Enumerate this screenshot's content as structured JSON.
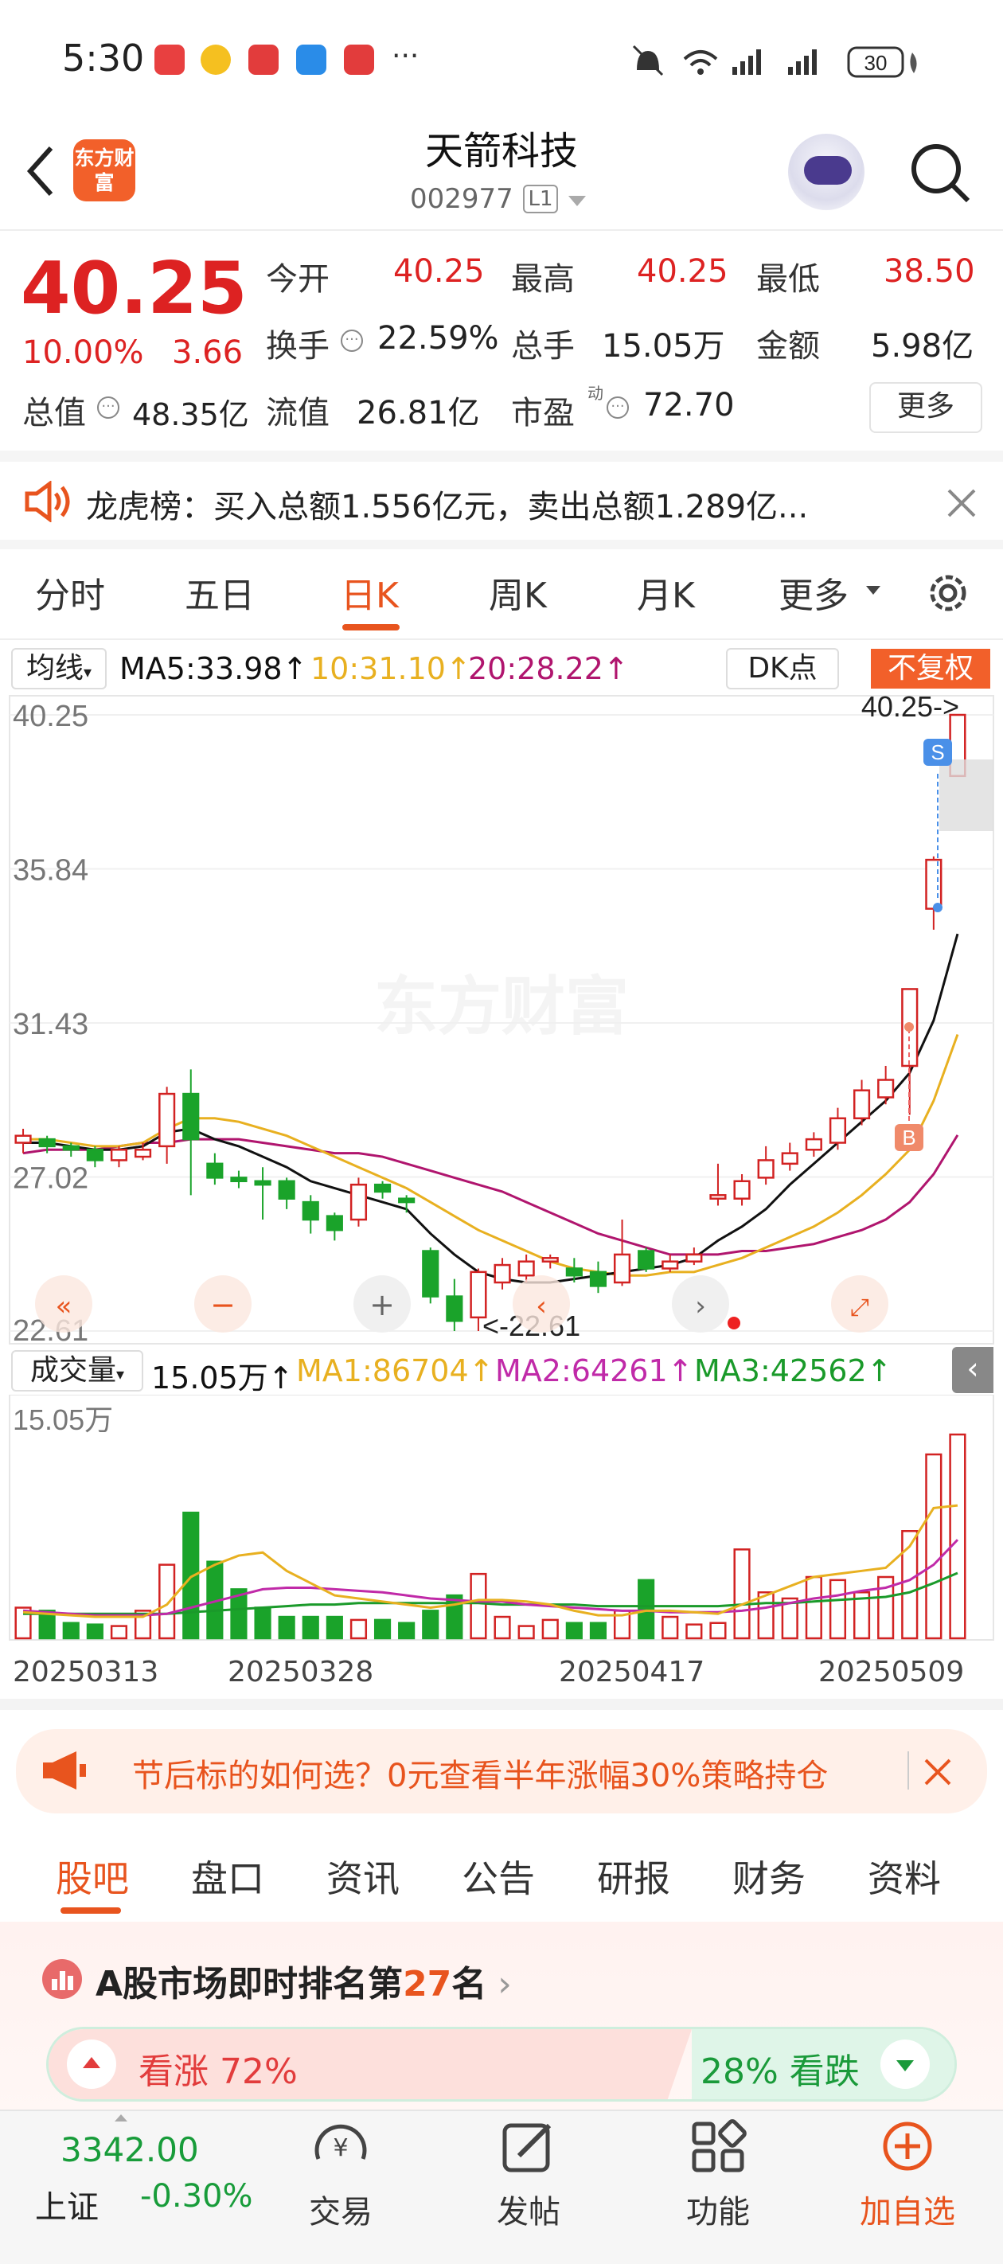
{
  "status_bar": {
    "time": "5:30",
    "battery": "30"
  },
  "header": {
    "logo_text": "东方财富",
    "title": "天箭科技",
    "code": "002977",
    "level_badge": "L1"
  },
  "quote": {
    "price": "40.25",
    "change_pct": "10.00%",
    "change": "3.66",
    "open_label": "今开",
    "open": "40.25",
    "high_label": "最高",
    "high": "40.25",
    "low_label": "最低",
    "low": "38.50",
    "turnover_label": "换手",
    "turnover": "22.59%",
    "volume_label": "总手",
    "volume": "15.05万",
    "amount_label": "金额",
    "amount": "5.98亿",
    "mktcap_label": "总值",
    "mktcap": "48.35亿",
    "float_label": "流值",
    "float": "26.81亿",
    "pe_label": "市盈",
    "pe_sup": "动",
    "pe": "72.70",
    "more": "更多"
  },
  "notice": {
    "text": "龙虎榜：买入总额1.556亿元，卖出总额1.289亿..."
  },
  "chart_tabs": [
    "分时",
    "五日",
    "日K",
    "周K",
    "月K",
    "更多"
  ],
  "chart_tabs_active": 2,
  "kline": {
    "ma_selector": "均线",
    "ma5": "MA5:33.98↑",
    "ma10": "10:31.10↑",
    "ma20": "20:28.22↑",
    "dk": "DK点",
    "adjust": "不复权",
    "y_labels": [
      "40.25",
      "35.84",
      "31.43",
      "27.02",
      "22.61"
    ],
    "high_marker": "40.25->",
    "low_marker": "<-22.61",
    "sell_badge": "S",
    "buy_badge": "B",
    "watermark": "东方财富"
  },
  "volume": {
    "selector": "成交量",
    "current": "15.05万↑",
    "ma1": "MA1:86704↑",
    "ma2": "MA2:64261↑",
    "ma3": "MA3:42562↑",
    "max_label": "15.05万",
    "x_labels": [
      "20250313",
      "20250328",
      "20250417",
      "20250509"
    ]
  },
  "chart_data": {
    "type": "candlestick",
    "ylim": [
      22.61,
      40.25
    ],
    "candles": [
      {
        "o": 28.0,
        "c": 28.2,
        "h": 28.4,
        "l": 27.7
      },
      {
        "o": 28.1,
        "c": 27.9,
        "h": 28.2,
        "l": 27.7
      },
      {
        "o": 27.9,
        "c": 27.8,
        "h": 28.0,
        "l": 27.6
      },
      {
        "o": 27.8,
        "c": 27.5,
        "h": 27.9,
        "l": 27.3
      },
      {
        "o": 27.5,
        "c": 27.8,
        "h": 27.9,
        "l": 27.3
      },
      {
        "o": 27.6,
        "c": 27.8,
        "h": 28.0,
        "l": 27.5
      },
      {
        "o": 27.9,
        "c": 29.4,
        "h": 29.6,
        "l": 27.4
      },
      {
        "o": 29.4,
        "c": 28.1,
        "h": 30.1,
        "l": 26.5
      },
      {
        "o": 27.4,
        "c": 27.0,
        "h": 27.7,
        "l": 26.8
      },
      {
        "o": 27.0,
        "c": 26.9,
        "h": 27.2,
        "l": 26.7
      },
      {
        "o": 26.9,
        "c": 26.8,
        "h": 27.3,
        "l": 25.8
      },
      {
        "o": 26.9,
        "c": 26.4,
        "h": 27.0,
        "l": 26.1
      },
      {
        "o": 26.3,
        "c": 25.8,
        "h": 26.5,
        "l": 25.4
      },
      {
        "o": 25.9,
        "c": 25.5,
        "h": 26.0,
        "l": 25.2
      },
      {
        "o": 25.8,
        "c": 26.8,
        "h": 27.0,
        "l": 25.6
      },
      {
        "o": 26.8,
        "c": 26.6,
        "h": 26.9,
        "l": 26.4
      },
      {
        "o": 26.4,
        "c": 26.3,
        "h": 26.5,
        "l": 26.0
      },
      {
        "o": 24.9,
        "c": 23.6,
        "h": 25.0,
        "l": 23.4
      },
      {
        "o": 23.6,
        "c": 22.9,
        "h": 24.1,
        "l": 22.61
      },
      {
        "o": 23.0,
        "c": 24.3,
        "h": 24.4,
        "l": 22.61
      },
      {
        "o": 24.0,
        "c": 24.5,
        "h": 24.7,
        "l": 23.8
      },
      {
        "o": 24.2,
        "c": 24.6,
        "h": 24.8,
        "l": 24.0
      },
      {
        "o": 24.6,
        "c": 24.7,
        "h": 24.8,
        "l": 24.4
      },
      {
        "o": 24.4,
        "c": 24.2,
        "h": 24.7,
        "l": 24.0
      },
      {
        "o": 24.3,
        "c": 23.9,
        "h": 24.6,
        "l": 23.7
      },
      {
        "o": 24.0,
        "c": 24.8,
        "h": 25.8,
        "l": 23.9
      },
      {
        "o": 24.9,
        "c": 24.4,
        "h": 25.0,
        "l": 24.3
      },
      {
        "o": 24.4,
        "c": 24.6,
        "h": 24.8,
        "l": 24.3
      },
      {
        "o": 24.6,
        "c": 24.8,
        "h": 25.0,
        "l": 24.5
      },
      {
        "o": 26.4,
        "c": 26.5,
        "h": 27.4,
        "l": 26.2
      },
      {
        "o": 26.4,
        "c": 26.9,
        "h": 27.1,
        "l": 26.2
      },
      {
        "o": 27.0,
        "c": 27.5,
        "h": 27.9,
        "l": 26.8
      },
      {
        "o": 27.4,
        "c": 27.7,
        "h": 28.0,
        "l": 27.2
      },
      {
        "o": 27.8,
        "c": 28.1,
        "h": 28.3,
        "l": 27.6
      },
      {
        "o": 28.0,
        "c": 28.7,
        "h": 29.0,
        "l": 27.8
      },
      {
        "o": 28.7,
        "c": 29.5,
        "h": 29.8,
        "l": 28.5
      },
      {
        "o": 29.3,
        "c": 29.8,
        "h": 30.2,
        "l": 29.1
      },
      {
        "o": 30.2,
        "c": 32.4,
        "h": 32.4,
        "l": 28.8
      },
      {
        "o": 34.7,
        "c": 36.1,
        "h": 36.2,
        "l": 34.1
      },
      {
        "o": 38.5,
        "c": 40.25,
        "h": 40.25,
        "l": 38.5
      }
    ],
    "ma5": [
      28.0,
      28.0,
      27.9,
      27.8,
      27.8,
      27.9,
      28.3,
      28.4,
      28.1,
      27.9,
      27.6,
      27.3,
      26.9,
      26.7,
      26.5,
      26.3,
      26.1,
      25.4,
      24.8,
      24.3,
      24.1,
      24.0,
      24.0,
      24.1,
      24.2,
      24.3,
      24.4,
      24.5,
      24.7,
      25.2,
      25.6,
      26.1,
      26.8,
      27.4,
      28.0,
      28.6,
      29.2,
      30.0,
      31.5,
      33.98
    ],
    "ma10": [
      28.1,
      28.1,
      28.0,
      27.9,
      27.9,
      28.0,
      28.4,
      28.7,
      28.7,
      28.6,
      28.4,
      28.2,
      27.9,
      27.6,
      27.3,
      27.0,
      26.7,
      26.3,
      25.9,
      25.5,
      25.2,
      24.9,
      24.6,
      24.4,
      24.3,
      24.2,
      24.2,
      24.3,
      24.3,
      24.5,
      24.7,
      25.0,
      25.3,
      25.6,
      26.0,
      26.5,
      27.1,
      27.8,
      29.2,
      31.1
    ],
    "ma20": [
      27.7,
      27.8,
      27.8,
      27.8,
      27.9,
      28.0,
      28.0,
      28.1,
      28.1,
      28.1,
      28.0,
      27.9,
      27.8,
      27.7,
      27.7,
      27.6,
      27.4,
      27.2,
      27.0,
      26.8,
      26.6,
      26.3,
      26.0,
      25.7,
      25.4,
      25.2,
      25.0,
      24.8,
      24.8,
      24.8,
      24.9,
      24.9,
      25.0,
      25.1,
      25.3,
      25.5,
      25.8,
      26.3,
      27.1,
      28.22
    ],
    "volumes": [
      20,
      18,
      10,
      9,
      8,
      18,
      48,
      82,
      50,
      32,
      20,
      14,
      14,
      14,
      12,
      12,
      10,
      18,
      28,
      42,
      14,
      8,
      12,
      10,
      10,
      18,
      38,
      14,
      9,
      10,
      58,
      30,
      26,
      40,
      38,
      30,
      40,
      70,
      120,
      133
    ],
    "vol_ma1": [
      17,
      16,
      15,
      14,
      14,
      14,
      22,
      40,
      48,
      54,
      56,
      44,
      36,
      28,
      26,
      24,
      22,
      20,
      22,
      25,
      25,
      24,
      22,
      18,
      15,
      15,
      18,
      18,
      17,
      16,
      22,
      28,
      34,
      40,
      42,
      44,
      46,
      60,
      85,
      86.7
    ],
    "vol_ma2": [
      18,
      17,
      16,
      15,
      15,
      15,
      16,
      20,
      24,
      28,
      32,
      33,
      33,
      32,
      31,
      30,
      28,
      26,
      25,
      24,
      24,
      22,
      21,
      20,
      19,
      18,
      18,
      17,
      17,
      17,
      18,
      20,
      23,
      26,
      28,
      31,
      33,
      38,
      48,
      64.3
    ],
    "vol_ma3": [
      16,
      16,
      16,
      16,
      16,
      16,
      16,
      17,
      18,
      19,
      20,
      21,
      22,
      22,
      23,
      23,
      23,
      23,
      23,
      23,
      22,
      22,
      22,
      22,
      21,
      21,
      21,
      21,
      21,
      21,
      22,
      23,
      23,
      24,
      25,
      26,
      27,
      30,
      36,
      42.6
    ]
  },
  "ad": {
    "text": "节后标的如何选？0元查看半年涨幅30%策略持仓"
  },
  "bottom_tabs": [
    "股吧",
    "盘口",
    "资讯",
    "公告",
    "研报",
    "财务",
    "资料"
  ],
  "bottom_tabs_active": 0,
  "rank": {
    "prefix": "A股市场即时排名第",
    "num": "27",
    "suffix": "名"
  },
  "vote": {
    "up_label": "看涨 72%",
    "down_label": "28% 看跌",
    "up_pct": 72
  },
  "index": {
    "value": "3342.00",
    "name": "上证",
    "change": "-0.30%"
  },
  "bottom_bar": [
    "交易",
    "发帖",
    "功能",
    "加自选"
  ],
  "colors": {
    "accent": "#e8541e",
    "up": "#d22222",
    "down": "#1aa32a",
    "ma5": "#111111",
    "ma10": "#e8b020",
    "ma20": "#b0156e"
  }
}
